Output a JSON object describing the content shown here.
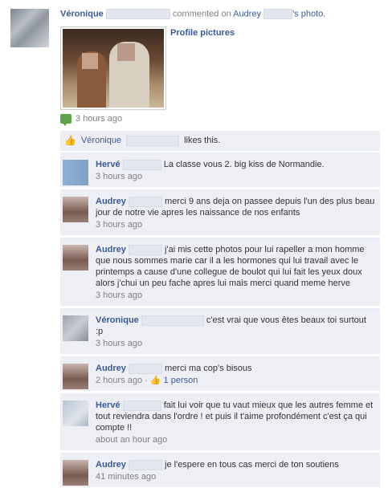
{
  "story": {
    "actor": "Véronique",
    "action": "commented on",
    "target": "Audrey",
    "target_suffix": "'s photo.",
    "album": "Profile pictures",
    "time": "3 hours ago"
  },
  "like_row": {
    "name": "Véronique",
    "text": "likes this."
  },
  "comments": [
    {
      "name": "Hervé",
      "text": "La classe vous 2. big kiss de Normandie.",
      "time": "3 hours ago"
    },
    {
      "name": "Audrey",
      "text": "merci 9 ans deja on passee depuis l'un des plus beau jour de notre vie apres les naissance de nos enfants",
      "time": "3 hours ago"
    },
    {
      "name": "Audrey",
      "text": "j'ai mis cette photos pour lui rapeller a mon homme que nous sommes marie car il a les hormones qui lui travail avec le printemps a cause d'une collegue de boulot qui lui fait les yeux doux alors j'chui un peu fache apres lui mais merci quand meme herve",
      "time": "3 hours ago"
    },
    {
      "name": "Véronique",
      "text": "c'est vrai que vous êtes beaux toi surtout :p",
      "time": "3 hours ago"
    },
    {
      "name": "Audrey",
      "text": "merci ma cop's bisous",
      "time": "2 hours ago",
      "likes": "1 person"
    },
    {
      "name": "Hervé",
      "text": "fait lui voir que tu vaut mieux que les autres femme et tout reviendra dans l'ordre ! et puis il t'aime profondément c'est ça qui compte !!",
      "time": "about an hour ago"
    },
    {
      "name": "Audrey",
      "text": "je l'espere en tous cas merci de ton soutiens",
      "time": "41 minutes ago"
    }
  ]
}
